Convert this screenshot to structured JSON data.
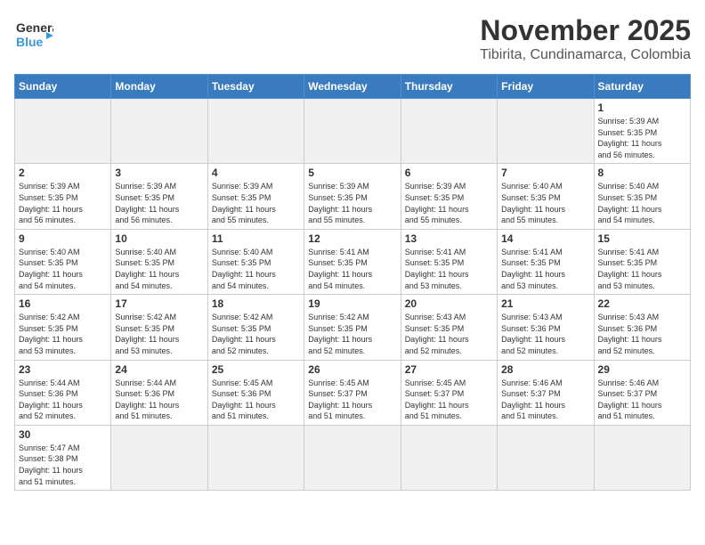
{
  "header": {
    "logo_general": "General",
    "logo_blue": "Blue",
    "month": "November 2025",
    "location": "Tibirita, Cundinamarca, Colombia"
  },
  "weekdays": [
    "Sunday",
    "Monday",
    "Tuesday",
    "Wednesday",
    "Thursday",
    "Friday",
    "Saturday"
  ],
  "cells": [
    {
      "day": "",
      "text": ""
    },
    {
      "day": "",
      "text": ""
    },
    {
      "day": "",
      "text": ""
    },
    {
      "day": "",
      "text": ""
    },
    {
      "day": "",
      "text": ""
    },
    {
      "day": "",
      "text": ""
    },
    {
      "day": "1",
      "text": "Sunrise: 5:39 AM\nSunset: 5:35 PM\nDaylight: 11 hours\nand 56 minutes."
    },
    {
      "day": "2",
      "text": "Sunrise: 5:39 AM\nSunset: 5:35 PM\nDaylight: 11 hours\nand 56 minutes."
    },
    {
      "day": "3",
      "text": "Sunrise: 5:39 AM\nSunset: 5:35 PM\nDaylight: 11 hours\nand 56 minutes."
    },
    {
      "day": "4",
      "text": "Sunrise: 5:39 AM\nSunset: 5:35 PM\nDaylight: 11 hours\nand 55 minutes."
    },
    {
      "day": "5",
      "text": "Sunrise: 5:39 AM\nSunset: 5:35 PM\nDaylight: 11 hours\nand 55 minutes."
    },
    {
      "day": "6",
      "text": "Sunrise: 5:39 AM\nSunset: 5:35 PM\nDaylight: 11 hours\nand 55 minutes."
    },
    {
      "day": "7",
      "text": "Sunrise: 5:40 AM\nSunset: 5:35 PM\nDaylight: 11 hours\nand 55 minutes."
    },
    {
      "day": "8",
      "text": "Sunrise: 5:40 AM\nSunset: 5:35 PM\nDaylight: 11 hours\nand 54 minutes."
    },
    {
      "day": "9",
      "text": "Sunrise: 5:40 AM\nSunset: 5:35 PM\nDaylight: 11 hours\nand 54 minutes."
    },
    {
      "day": "10",
      "text": "Sunrise: 5:40 AM\nSunset: 5:35 PM\nDaylight: 11 hours\nand 54 minutes."
    },
    {
      "day": "11",
      "text": "Sunrise: 5:40 AM\nSunset: 5:35 PM\nDaylight: 11 hours\nand 54 minutes."
    },
    {
      "day": "12",
      "text": "Sunrise: 5:41 AM\nSunset: 5:35 PM\nDaylight: 11 hours\nand 54 minutes."
    },
    {
      "day": "13",
      "text": "Sunrise: 5:41 AM\nSunset: 5:35 PM\nDaylight: 11 hours\nand 53 minutes."
    },
    {
      "day": "14",
      "text": "Sunrise: 5:41 AM\nSunset: 5:35 PM\nDaylight: 11 hours\nand 53 minutes."
    },
    {
      "day": "15",
      "text": "Sunrise: 5:41 AM\nSunset: 5:35 PM\nDaylight: 11 hours\nand 53 minutes."
    },
    {
      "day": "16",
      "text": "Sunrise: 5:42 AM\nSunset: 5:35 PM\nDaylight: 11 hours\nand 53 minutes."
    },
    {
      "day": "17",
      "text": "Sunrise: 5:42 AM\nSunset: 5:35 PM\nDaylight: 11 hours\nand 53 minutes."
    },
    {
      "day": "18",
      "text": "Sunrise: 5:42 AM\nSunset: 5:35 PM\nDaylight: 11 hours\nand 52 minutes."
    },
    {
      "day": "19",
      "text": "Sunrise: 5:42 AM\nSunset: 5:35 PM\nDaylight: 11 hours\nand 52 minutes."
    },
    {
      "day": "20",
      "text": "Sunrise: 5:43 AM\nSunset: 5:35 PM\nDaylight: 11 hours\nand 52 minutes."
    },
    {
      "day": "21",
      "text": "Sunrise: 5:43 AM\nSunset: 5:36 PM\nDaylight: 11 hours\nand 52 minutes."
    },
    {
      "day": "22",
      "text": "Sunrise: 5:43 AM\nSunset: 5:36 PM\nDaylight: 11 hours\nand 52 minutes."
    },
    {
      "day": "23",
      "text": "Sunrise: 5:44 AM\nSunset: 5:36 PM\nDaylight: 11 hours\nand 52 minutes."
    },
    {
      "day": "24",
      "text": "Sunrise: 5:44 AM\nSunset: 5:36 PM\nDaylight: 11 hours\nand 51 minutes."
    },
    {
      "day": "25",
      "text": "Sunrise: 5:45 AM\nSunset: 5:36 PM\nDaylight: 11 hours\nand 51 minutes."
    },
    {
      "day": "26",
      "text": "Sunrise: 5:45 AM\nSunset: 5:37 PM\nDaylight: 11 hours\nand 51 minutes."
    },
    {
      "day": "27",
      "text": "Sunrise: 5:45 AM\nSunset: 5:37 PM\nDaylight: 11 hours\nand 51 minutes."
    },
    {
      "day": "28",
      "text": "Sunrise: 5:46 AM\nSunset: 5:37 PM\nDaylight: 11 hours\nand 51 minutes."
    },
    {
      "day": "29",
      "text": "Sunrise: 5:46 AM\nSunset: 5:37 PM\nDaylight: 11 hours\nand 51 minutes."
    },
    {
      "day": "30",
      "text": "Sunrise: 5:47 AM\nSunset: 5:38 PM\nDaylight: 11 hours\nand 51 minutes."
    },
    {
      "day": "",
      "text": ""
    },
    {
      "day": "",
      "text": ""
    },
    {
      "day": "",
      "text": ""
    },
    {
      "day": "",
      "text": ""
    },
    {
      "day": "",
      "text": ""
    },
    {
      "day": "",
      "text": ""
    }
  ]
}
